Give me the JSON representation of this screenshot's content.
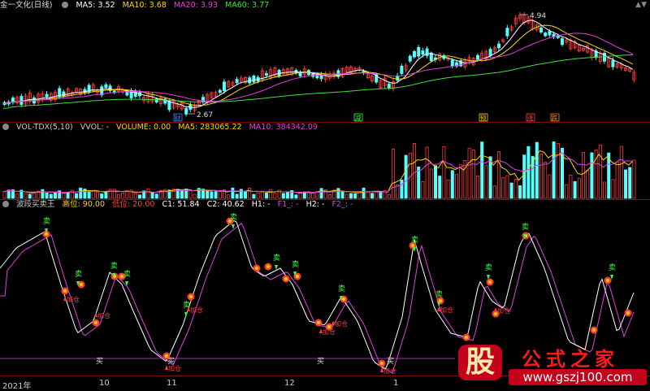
{
  "main_pane": {
    "title": "金一文化(日线)",
    "ma": [
      {
        "label": "MA5: 3.52",
        "color": "#ffffff"
      },
      {
        "label": "MA10: 3.68",
        "color": "#ffd700"
      },
      {
        "label": "MA20: 3.93",
        "color": "#e040e0"
      },
      {
        "label": "MA60: 3.77",
        "color": "#40e040"
      }
    ],
    "high_label": "4.94",
    "low_label": "2.67",
    "markers": [
      "财",
      "减",
      "预",
      "涨",
      "跌"
    ]
  },
  "volume_pane": {
    "items": [
      {
        "label": "VOL-TDX(5,10)",
        "color": "#cccccc"
      },
      {
        "label": "VVOL: -",
        "color": "#cccccc"
      },
      {
        "label": "VOLUME: 0.00",
        "color": "#ffd700"
      },
      {
        "label": "MA5: 283065.22",
        "color": "#ffd700"
      },
      {
        "label": "MA10: 384342.09",
        "color": "#e040e0"
      }
    ]
  },
  "indicator_pane": {
    "items": [
      {
        "label": "波段买卖王",
        "color": "#cccccc"
      },
      {
        "label": "高位: 90.00",
        "color": "#ffd700"
      },
      {
        "label": "低位: 20.00",
        "color": "#ff4040"
      },
      {
        "label": "C1: 51.84",
        "color": "#ffffff"
      },
      {
        "label": "C2: 40.62",
        "color": "#ffffff"
      },
      {
        "label": "H1: -",
        "color": "#ffffff"
      },
      {
        "label": "F1_: -",
        "color": "#e040e0"
      },
      {
        "label": "H2: -",
        "color": "#ffffff"
      },
      {
        "label": "F2_: -",
        "color": "#e040e0"
      }
    ],
    "buy_label": "买",
    "sell_label": "卖",
    "add_label": "加仓"
  },
  "x_axis": [
    "2021年",
    "10",
    "11",
    "12",
    "1"
  ],
  "watermark": {
    "logo": "股",
    "title": "公式之家",
    "url": "www.gszj100.com"
  },
  "chart_data": [
    {
      "type": "candlestick",
      "title": "金一文化(日线)",
      "series": [
        {
          "name": "MA5",
          "values": [
            3.52
          ]
        },
        {
          "name": "MA10",
          "values": [
            3.68
          ]
        },
        {
          "name": "MA20",
          "values": [
            3.93
          ]
        },
        {
          "name": "MA60",
          "values": [
            3.77
          ]
        }
      ],
      "annotations": [
        {
          "text": "4.94",
          "kind": "high"
        },
        {
          "text": "2.67",
          "kind": "low"
        }
      ]
    },
    {
      "type": "bar",
      "title": "VOL-TDX(5,10)",
      "series": [
        {
          "name": "VOLUME",
          "values": [
            0.0
          ]
        },
        {
          "name": "MA5",
          "values": [
            283065.22
          ]
        },
        {
          "name": "MA10",
          "values": [
            384342.09
          ]
        }
      ]
    },
    {
      "type": "line",
      "title": "波段买卖王",
      "series": [
        {
          "name": "高位",
          "values": [
            90.0
          ]
        },
        {
          "name": "低位",
          "values": [
            20.0
          ]
        },
        {
          "name": "C1",
          "values": [
            51.84
          ]
        },
        {
          "name": "C2",
          "values": [
            40.62
          ]
        }
      ]
    }
  ]
}
